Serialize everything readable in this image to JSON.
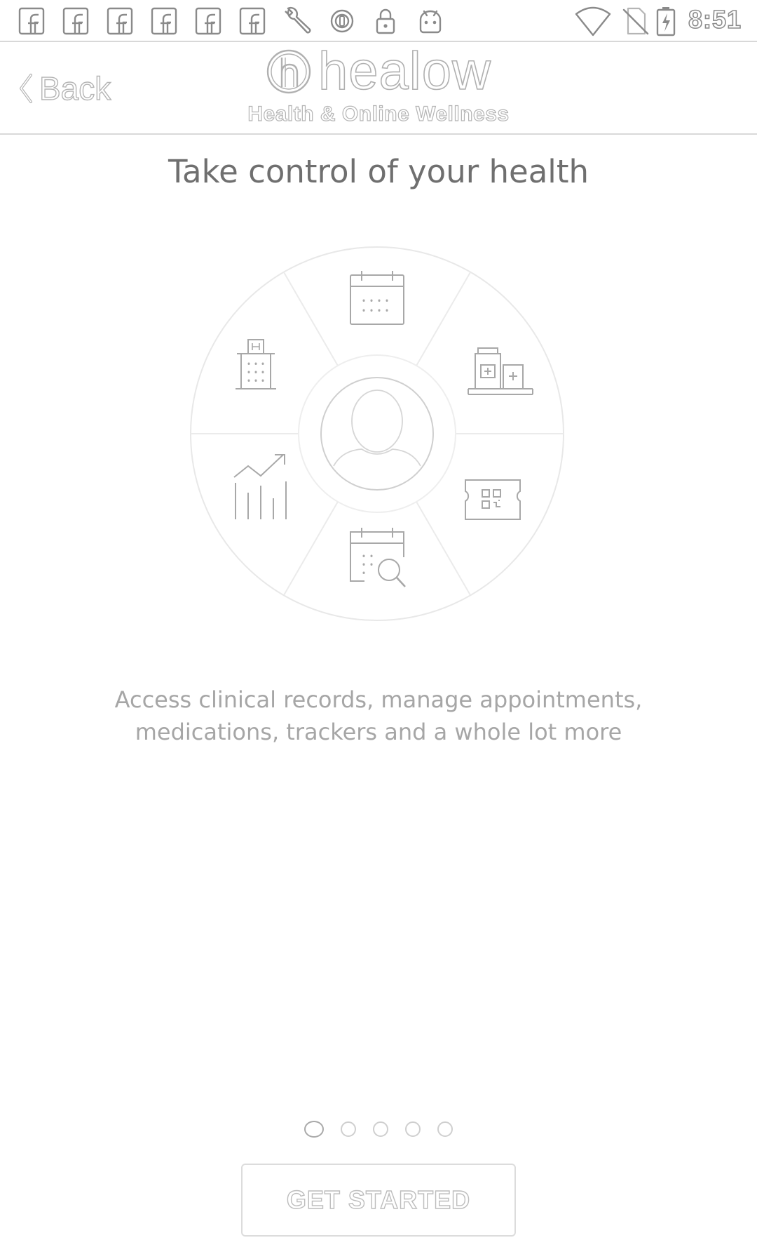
{
  "status_bar": {
    "time": "8:51",
    "notification_icons": [
      "facebook-icon",
      "facebook-icon",
      "facebook-icon",
      "facebook-icon",
      "facebook-icon",
      "facebook-icon",
      "wrench-icon",
      "vpn-key-icon",
      "lock-icon",
      "android-icon"
    ],
    "system_icons": [
      "wifi-icon",
      "no-sim-icon",
      "battery-charging-icon"
    ]
  },
  "header": {
    "back_label": "Back",
    "brand_name": "healow",
    "brand_tagline": "Health & Online Wellness"
  },
  "onboarding": {
    "title": "Take control of your health",
    "feature_icons": [
      "calendar-icon",
      "pharmacy-icon",
      "qr-ticket-icon",
      "appointment-search-icon",
      "trends-chart-icon",
      "hospital-icon"
    ],
    "center_icon": "user-avatar-icon",
    "description": "Access clinical records, manage appointments, medications, trackers and a whole lot more"
  },
  "pager": {
    "total_pages": 5,
    "current_page": 1
  },
  "actions": {
    "get_started_label": "GET STARTED"
  },
  "colors": {
    "title_text": "#6f6f6f",
    "body_text": "#a6a6a6",
    "outline": "#b4b4b4",
    "divider": "#d9d9d9"
  }
}
